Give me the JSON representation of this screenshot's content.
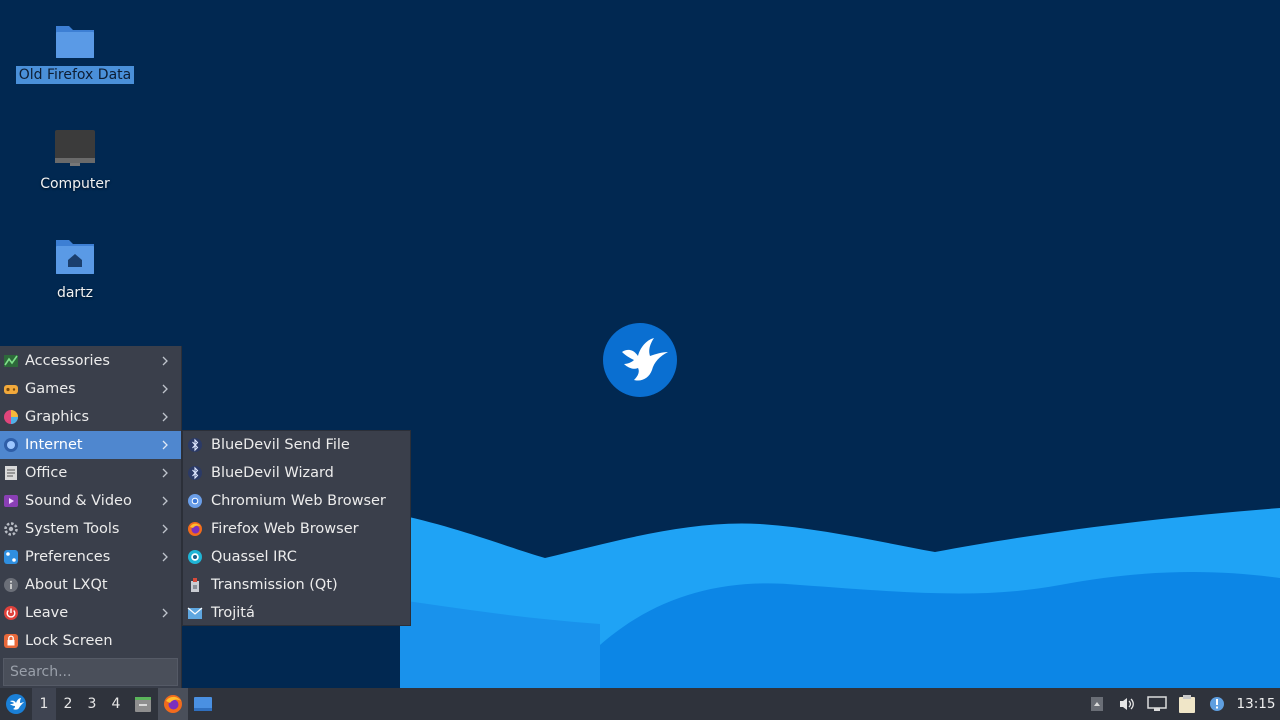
{
  "desktop": {
    "icons": [
      {
        "label": "Old Firefox Data",
        "icon": "folder-icon",
        "selected": true
      },
      {
        "label": "Computer",
        "icon": "computer-icon",
        "selected": false
      },
      {
        "label": "dartz",
        "icon": "home-folder-icon",
        "selected": false
      }
    ],
    "wallpaper_logo": "lubuntu-bird-logo"
  },
  "start_menu": {
    "items": [
      {
        "label": "Accessories",
        "icon": "accessories-icon",
        "submenu": true
      },
      {
        "label": "Games",
        "icon": "games-icon",
        "submenu": true
      },
      {
        "label": "Graphics",
        "icon": "graphics-icon",
        "submenu": true
      },
      {
        "label": "Internet",
        "icon": "internet-icon",
        "submenu": true,
        "active": true
      },
      {
        "label": "Office",
        "icon": "office-icon",
        "submenu": true
      },
      {
        "label": "Sound & Video",
        "icon": "sound-video-icon",
        "submenu": true
      },
      {
        "label": "System Tools",
        "icon": "system-tools-icon",
        "submenu": true
      },
      {
        "label": "Preferences",
        "icon": "preferences-icon",
        "submenu": true
      },
      {
        "label": "About LXQt",
        "icon": "info-icon",
        "submenu": false
      },
      {
        "label": "Leave",
        "icon": "power-icon",
        "submenu": true
      },
      {
        "label": "Lock Screen",
        "icon": "lock-icon",
        "submenu": false
      }
    ],
    "search_placeholder": "Search..."
  },
  "internet_submenu": {
    "items": [
      {
        "label": "BlueDevil Send File",
        "icon": "bluetooth-icon"
      },
      {
        "label": "BlueDevil Wizard",
        "icon": "bluetooth-icon"
      },
      {
        "label": "Chromium Web Browser",
        "icon": "chromium-icon"
      },
      {
        "label": "Firefox Web Browser",
        "icon": "firefox-icon"
      },
      {
        "label": "Quassel IRC",
        "icon": "quassel-icon"
      },
      {
        "label": "Transmission (Qt)",
        "icon": "transmission-icon"
      },
      {
        "label": "Trojitá",
        "icon": "trojita-mail-icon"
      }
    ]
  },
  "taskbar": {
    "workspaces": [
      "1",
      "2",
      "3",
      "4"
    ],
    "active_workspace": "1",
    "quicklaunch": [
      "file-manager-icon",
      "firefox-icon",
      "show-desktop-icon"
    ],
    "tray": [
      "tray-arrow-icon",
      "volume-icon",
      "network-icon",
      "clipboard-icon",
      "update-notifier-icon"
    ],
    "clock": "13:15"
  },
  "colors": {
    "desktop_bg": "#012851",
    "wave_light": "#1e9bf0",
    "wave_mid": "#0a7fe0",
    "menu_bg": "#3a3f4b",
    "menu_highlight": "#4f87cf",
    "taskbar_bg": "#2f333c"
  }
}
